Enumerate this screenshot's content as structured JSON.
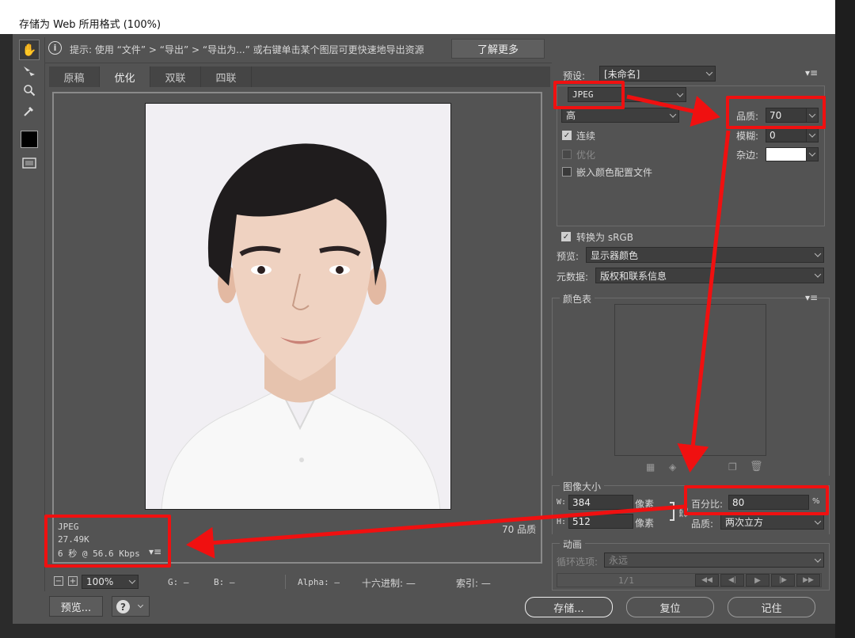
{
  "window": {
    "title": "存储为 Web 所用格式 (100%)"
  },
  "hint": {
    "text": "提示: 使用 “文件” > “导出” > “导出为...” 或右键单击某个图层可更快速地导出资源",
    "more_button": "了解更多"
  },
  "tabs": [
    {
      "label": "原稿"
    },
    {
      "label": "优化"
    },
    {
      "label": "双联"
    },
    {
      "label": "四联"
    }
  ],
  "image_info": {
    "format": "JPEG",
    "size": "27.49K",
    "time": "6 秒 @ 56.6 Kbps",
    "quality": "70 品质"
  },
  "status_bar": {
    "zoom": "100%",
    "g": "G: —",
    "b": "B: —",
    "alpha": "Alpha: —",
    "hex": "十六进制: —",
    "index": "索引: —"
  },
  "settings": {
    "preset_label": "预设:",
    "preset_value": "[未命名]",
    "format_value": "JPEG",
    "quality_level": "高",
    "quality_label": "品质:",
    "quality_value": "70",
    "blur_label": "模糊:",
    "blur_value": "0",
    "matte_label": "杂边:",
    "progressive_label": "连续",
    "optimized_label": "优化",
    "embed_profile_label": "嵌入颜色配置文件",
    "convert_srgb_label": "转换为 sRGB",
    "preview_label": "预览:",
    "preview_value": "显示器颜色",
    "metadata_label": "元数据:",
    "metadata_value": "版权和联系信息"
  },
  "color_table": {
    "title": "颜色表"
  },
  "image_size": {
    "title": "图像大小",
    "w_label": "W:",
    "w_value": "384",
    "w_unit": "像素",
    "h_label": "H:",
    "h_value": "512",
    "h_unit": "像素",
    "percent_label": "百分比:",
    "percent_value": "80",
    "percent_unit": "%",
    "quality_label": "品质:",
    "quality_value": "两次立方"
  },
  "animation": {
    "title": "动画",
    "loop_label": "循环选项:",
    "loop_value": "永远",
    "frame": "1/1"
  },
  "buttons": {
    "preview": "预览...",
    "save": "存储...",
    "reset": "复位",
    "remember": "记住"
  },
  "colors": {
    "dialog_bg": "#535353",
    "annotation_red": "#f01010",
    "photo_bg": "#f1eff3"
  }
}
